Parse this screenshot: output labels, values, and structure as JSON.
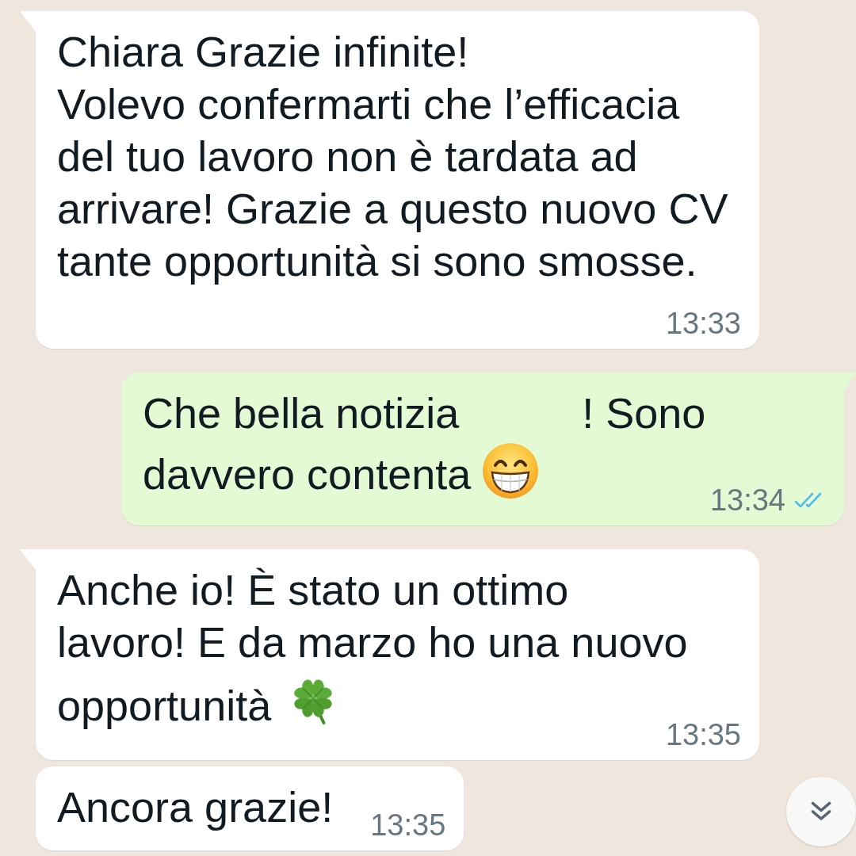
{
  "messages": [
    {
      "kind": "incoming",
      "tail": true,
      "rows": [
        [
          {
            "kind": "text",
            "text": "Chiara Grazie infinite!\nVolevo confermarti che l’efficacia del tuo lavoro non è tardata ad arrivare! Grazie a questo nuovo CV tante opportunità si sono smosse."
          }
        ]
      ],
      "time": "13:33"
    },
    {
      "kind": "outgoing",
      "tail": true,
      "rows": [
        [
          {
            "kind": "text",
            "text": "Che bella notizia"
          },
          {
            "kind": "gap"
          },
          {
            "kind": "text",
            "text": "! Sono"
          }
        ],
        [
          {
            "kind": "text",
            "text": "davvero contenta"
          },
          {
            "kind": "grin"
          }
        ]
      ],
      "time": "13:34",
      "receipt": {
        "read": true
      }
    },
    {
      "kind": "incoming",
      "tail": true,
      "rows": [
        [
          {
            "kind": "text",
            "text": "Anche io! È stato un ottimo"
          }
        ],
        [
          {
            "kind": "text",
            "text": "lavoro! E da marzo ho una nuovo"
          }
        ],
        [
          {
            "kind": "text",
            "text": "opportunità"
          },
          {
            "kind": "clover"
          }
        ]
      ],
      "time": "13:35"
    },
    {
      "kind": "incoming",
      "tail": false,
      "rows": [
        [
          {
            "kind": "text",
            "text": "Ancora grazie!"
          }
        ]
      ],
      "time": "13:35"
    }
  ],
  "scroll_to_bottom": true
}
